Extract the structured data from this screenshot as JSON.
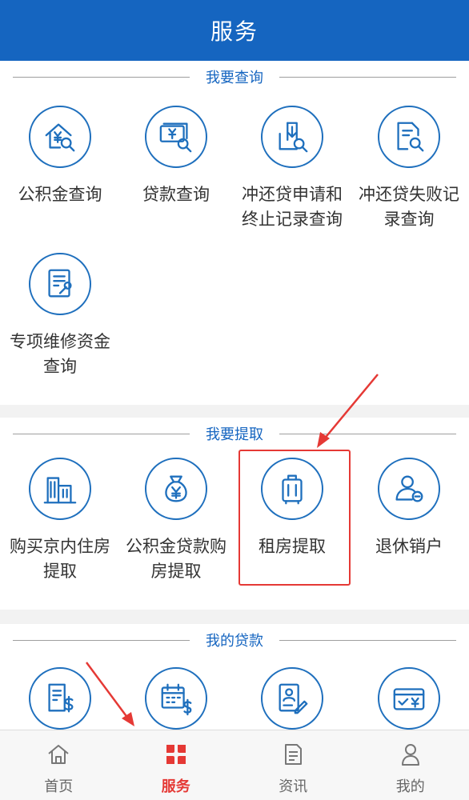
{
  "header": {
    "title": "服务"
  },
  "sections": [
    {
      "title": "我要查询",
      "items": [
        {
          "label": "公积金查询",
          "icon": "house-yuan-search-icon"
        },
        {
          "label": "贷款查询",
          "icon": "money-search-icon"
        },
        {
          "label": "冲还贷申请和终止记录查询",
          "icon": "download-doc-search-icon"
        },
        {
          "label": "冲还贷失败记录查询",
          "icon": "doc-search-icon"
        },
        {
          "label": "专项维修资金查询",
          "icon": "doc-wrench-icon"
        }
      ]
    },
    {
      "title": "我要提取",
      "items": [
        {
          "label": "购买京内住房提取",
          "icon": "buildings-icon"
        },
        {
          "label": "公积金贷款购房提取",
          "icon": "money-bag-icon"
        },
        {
          "label": "租房提取",
          "icon": "suitcase-icon"
        },
        {
          "label": "退休销户",
          "icon": "user-minus-icon"
        }
      ]
    },
    {
      "title": "我的贷款",
      "items": [
        {
          "label": "",
          "icon": "bill-dollar-icon"
        },
        {
          "label": "",
          "icon": "calendar-dollar-icon"
        },
        {
          "label": "",
          "icon": "profile-edit-icon"
        },
        {
          "label": "",
          "icon": "card-check-yuan-icon"
        }
      ]
    }
  ],
  "tabbar": [
    {
      "label": "首页",
      "icon": "home-icon",
      "active": false
    },
    {
      "label": "服务",
      "icon": "grid-icon",
      "active": true
    },
    {
      "label": "资讯",
      "icon": "news-icon",
      "active": false
    },
    {
      "label": "我的",
      "icon": "person-icon",
      "active": false
    }
  ],
  "colors": {
    "primary": "#1565c0",
    "accent_red": "#e53935",
    "text": "#333333"
  }
}
